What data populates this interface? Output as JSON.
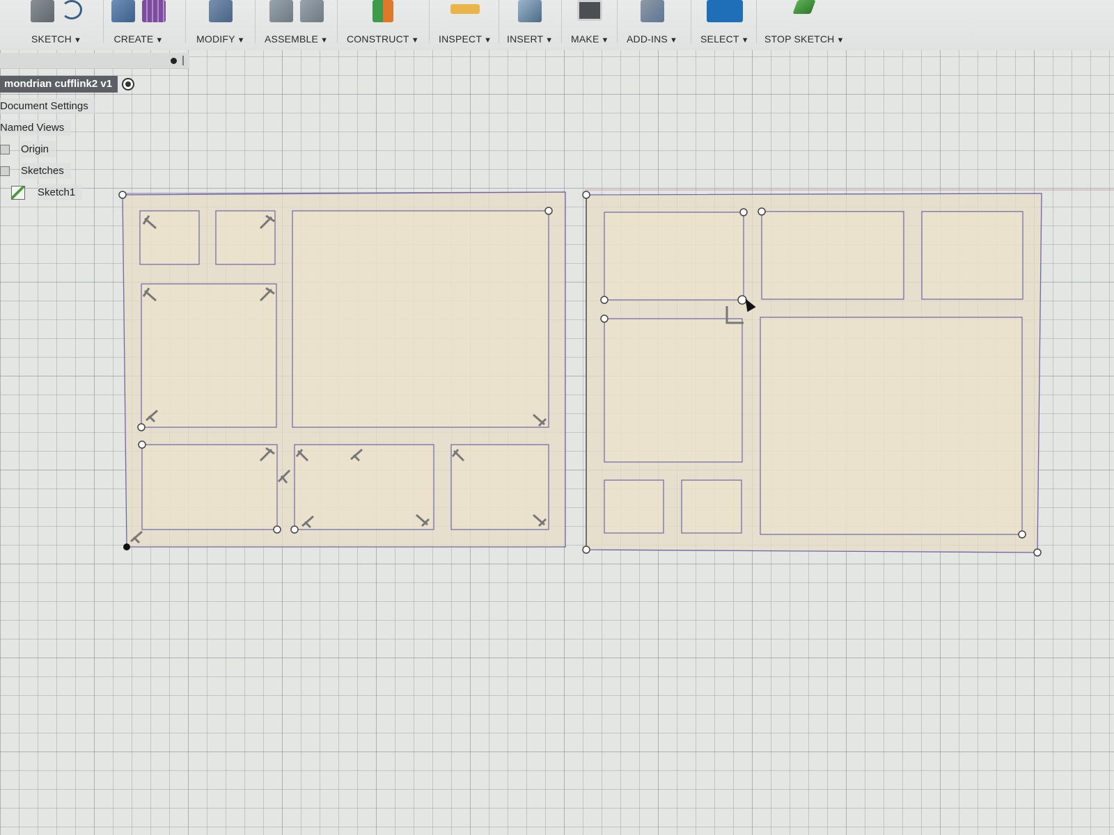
{
  "toolbar": {
    "groups": [
      {
        "label": "SKETCH",
        "icons": [
          "pencil-icon",
          "arc-icon"
        ]
      },
      {
        "label": "CREATE",
        "icons": [
          "extrude-icon",
          "pattern-grid-icon"
        ]
      },
      {
        "label": "MODIFY",
        "icons": [
          "press-pull-icon"
        ]
      },
      {
        "label": "ASSEMBLE",
        "icons": [
          "new-component-icon",
          "joint-icon"
        ]
      },
      {
        "label": "CONSTRUCT",
        "icons": [
          "offset-plane-icon"
        ]
      },
      {
        "label": "INSPECT",
        "icons": [
          "measure-icon"
        ]
      },
      {
        "label": "INSERT",
        "icons": [
          "insert-image-icon"
        ]
      },
      {
        "label": "MAKE",
        "icons": [
          "3d-print-icon"
        ]
      },
      {
        "label": "ADD-INS",
        "icons": [
          "scripts-gear-icon"
        ]
      },
      {
        "label": "SELECT",
        "icons": [
          "select-cursor-icon"
        ]
      },
      {
        "label": "STOP SKETCH",
        "icons": [
          "stop-sketch-check-icon"
        ]
      }
    ],
    "caret": "▼"
  },
  "browser": {
    "document_title": "mondrian cufflink2 v1",
    "items": [
      {
        "label": "Document Settings"
      },
      {
        "label": "Named Views"
      },
      {
        "label": "Origin"
      },
      {
        "label": "Sketches"
      },
      {
        "label": "Sketch1"
      }
    ]
  },
  "colors": {
    "sketch_fill": "#e8dcc6",
    "sketch_line": "#6b66a8",
    "constraint": "#777777",
    "select_blue": "#1f6fb8"
  }
}
